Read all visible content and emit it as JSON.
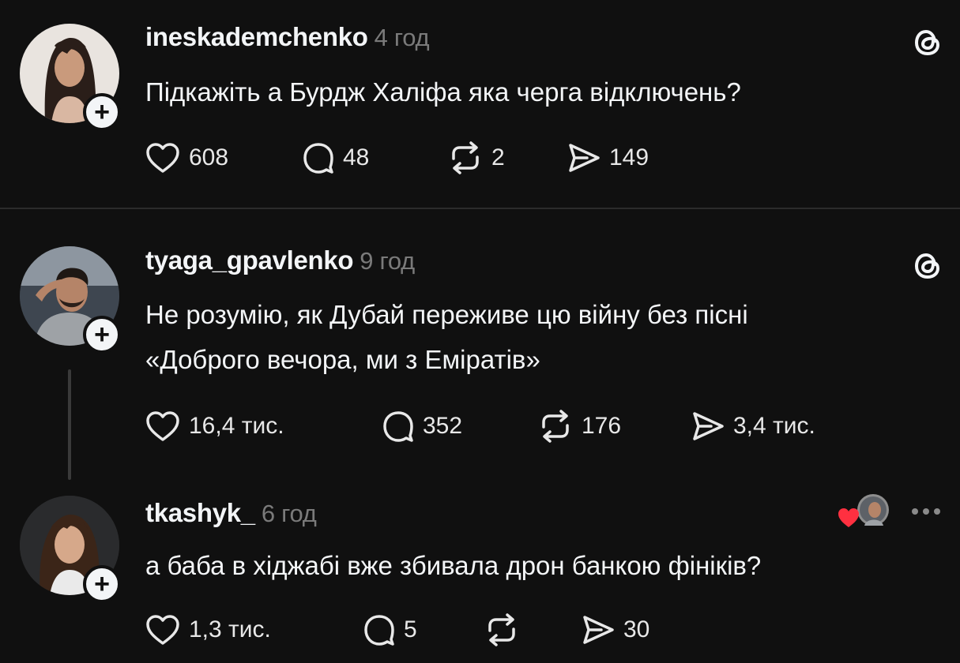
{
  "posts": [
    {
      "username": "ineskademchenko",
      "time": "4 год",
      "text_lines": [
        "Підкажіть а Бурдж Халіфа яка черга відключень?"
      ],
      "likes": "608",
      "replies": "48",
      "reposts": "2",
      "shares": "149"
    },
    {
      "username": "tyaga_gpavlenko",
      "time": "9 год",
      "text_lines": [
        "Не розумію, як Дубай переживе цю війну без пісні",
        "«Доброго вечора, ми з Еміратів»"
      ],
      "likes": "16,4 тис.",
      "replies": "352",
      "reposts": "176",
      "shares": "3,4 тис."
    },
    {
      "username": "tkashyk_",
      "time": "6 год",
      "text_lines": [
        "а баба в хіджабі вже збивала дрон банкою фініків?"
      ],
      "likes": "1,3 тис.",
      "replies": "5",
      "reposts": "",
      "shares": "30"
    }
  ],
  "icons": {
    "threads": "threads-logo-icon",
    "like": "heart-icon",
    "reply": "speech-bubble-icon",
    "repost": "repost-icon",
    "share": "send-icon",
    "follow": "plus-icon",
    "more": "more-dots-icon"
  },
  "colors": {
    "background": "#101010",
    "text": "#f3f5f7",
    "muted": "#7a7a7a",
    "liked_heart": "#ff3040"
  }
}
